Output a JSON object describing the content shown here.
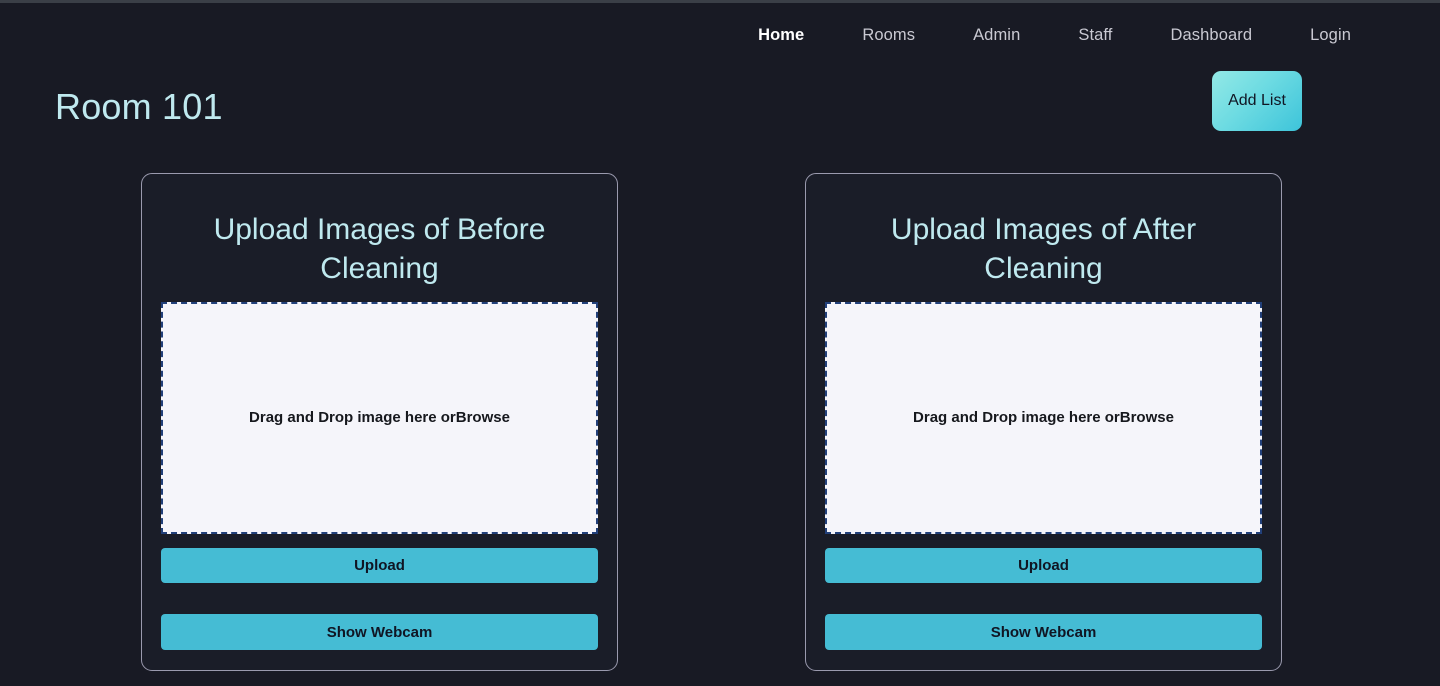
{
  "theme": {
    "page_background": "#181a24",
    "accent_cyan": "#45bcd4",
    "title_cyan": "#bfe9ef",
    "card_background": "#1a1d28",
    "card_border": "#9a9aae",
    "dropzone_background": "#f5f5fa",
    "dropzone_border": "#22407a",
    "nav_inactive": "#c9c9d2",
    "nav_active": "#ffffff"
  },
  "nav": {
    "items": [
      {
        "label": "Home",
        "active": true
      },
      {
        "label": "Rooms",
        "active": false
      },
      {
        "label": "Admin",
        "active": false
      },
      {
        "label": "Staff",
        "active": false
      },
      {
        "label": "Dashboard",
        "active": false
      },
      {
        "label": "Login",
        "active": false
      }
    ]
  },
  "header": {
    "title": "Room 101",
    "add_list_label": "Add List"
  },
  "cards": [
    {
      "title": "Upload Images of Before Cleaning",
      "dropzone": {
        "prompt": "Drag and Drop image here or",
        "browse_label": "Browse"
      },
      "upload_label": "Upload",
      "webcam_label": "Show Webcam"
    },
    {
      "title": "Upload Images of After Cleaning",
      "dropzone": {
        "prompt": "Drag and Drop image here or",
        "browse_label": "Browse"
      },
      "upload_label": "Upload",
      "webcam_label": "Show Webcam"
    }
  ]
}
